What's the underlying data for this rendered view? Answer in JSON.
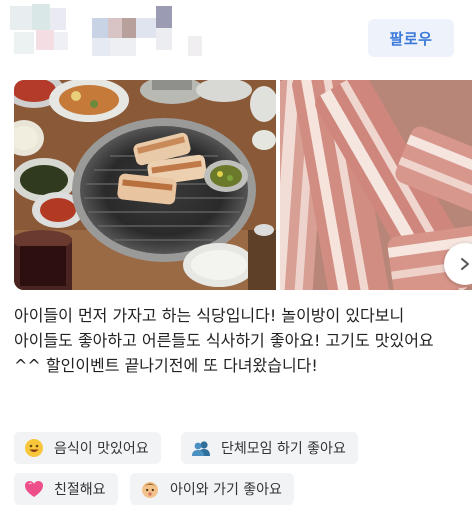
{
  "header": {
    "follow_label": "팔로우"
  },
  "photos": [
    {
      "subject": "grill-table"
    },
    {
      "subject": "raw-pork-belly"
    }
  ],
  "review": {
    "text": "아이들이 먼저 가자고 하는 식당입니다! 놀이방이 있다보니 아이들도 좋아하고 어른들도 식사하기 좋아요! 고기도 맛있어요^^ 할인이벤트 끝나기전에 또 다녀왔습니다!"
  },
  "keywords": [
    {
      "label": "음식이 맛있어요",
      "icon": "smile-face-icon"
    },
    {
      "label": "단체모임 하기 좋아요",
      "icon": "group-people-icon"
    },
    {
      "label": "친절해요",
      "icon": "heart-icon"
    },
    {
      "label": "아이와 가기 좋아요",
      "icon": "baby-face-icon"
    }
  ],
  "colors": {
    "follow_bg": "#eef3fb",
    "follow_text": "#3c7ad9",
    "chip_bg": "#f2f3f5"
  }
}
